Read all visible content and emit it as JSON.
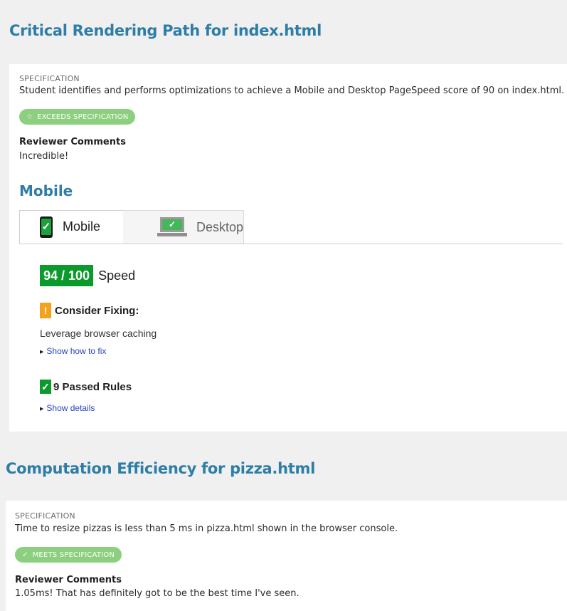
{
  "sections": [
    {
      "title": "Critical Rendering Path for index.html",
      "spec_label": "SPECIFICATION",
      "spec_text": "Student identifies and performs optimizations to achieve a Mobile and Desktop PageSpeed score of 90 on index.html.",
      "badge": {
        "icon": "star-icon",
        "label": "EXCEEDS SPECIFICATION",
        "color": "#8ccf7f"
      },
      "reviewer_title": "Reviewer Comments",
      "reviewer_text": "Incredible!",
      "subheading": "Mobile",
      "pagespeed": {
        "tabs": [
          {
            "label": "Mobile",
            "icon": "phone-icon",
            "active": true
          },
          {
            "label": "Desktop",
            "icon": "laptop-icon",
            "active": false
          }
        ],
        "score": "94 / 100",
        "score_value": 94,
        "score_label": "Speed",
        "consider_fixing": {
          "icon": "warning-icon",
          "icon_glyph": "!",
          "label": "Consider Fixing:",
          "items": [
            "Leverage browser caching"
          ],
          "link": "Show how to fix"
        },
        "passed": {
          "icon": "check-icon",
          "label": "9 Passed Rules",
          "link": "Show details"
        }
      }
    },
    {
      "title": "Computation Efficiency for pizza.html",
      "spec_label": "SPECIFICATION",
      "spec_text": "Time to resize pizzas is less than 5 ms in pizza.html shown in the browser console.",
      "badge": {
        "icon": "check-icon",
        "label": "MEETS SPECIFICATION",
        "color": "#8ccf7f"
      },
      "reviewer_title": "Reviewer Comments",
      "reviewer_text": "1.05ms! That has definitely got to be the best time I've seen."
    }
  ],
  "colors": {
    "heading_blue": "#2d7da8",
    "score_green": "#0c9a2c",
    "warning_orange": "#f4a21e",
    "link_blue": "#2244bb"
  }
}
